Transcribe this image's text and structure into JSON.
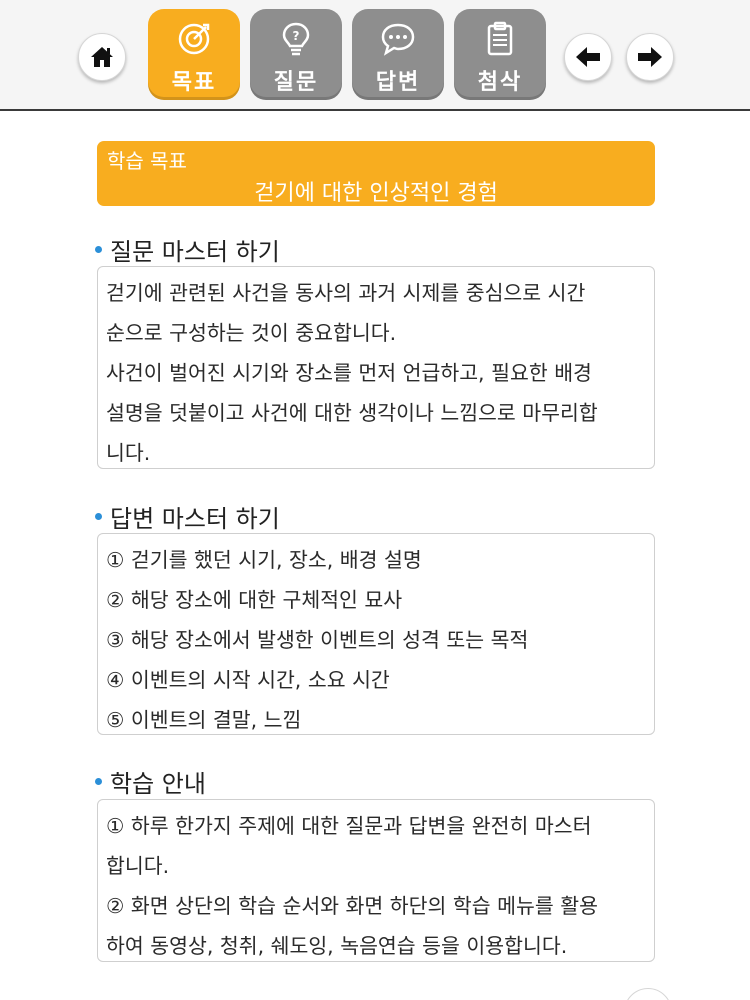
{
  "nav": {
    "tabs": [
      {
        "label": "목표",
        "icon": "target-icon",
        "active": true
      },
      {
        "label": "질문",
        "icon": "lightbulb-icon",
        "active": false
      },
      {
        "label": "답변",
        "icon": "speech-bubble-icon",
        "active": false
      },
      {
        "label": "첨삭",
        "icon": "clipboard-icon",
        "active": false
      }
    ],
    "home_icon": "home-icon",
    "prev_icon": "arrow-left-icon",
    "next_icon": "arrow-right-icon"
  },
  "colors": {
    "accent": "#f8ad1f",
    "tab_inactive": "#8e8e8e",
    "bullet": "#2b8fd8"
  },
  "goal": {
    "label": "학습 목표",
    "topic": "걷기에 대한 인상적인 경험"
  },
  "sections": [
    {
      "title": "질문 마스터 하기",
      "lines": [
        "걷기에 관련된 사건을 동사의 과거 시제를 중심으로 시간",
        "순으로 구성하는 것이 중요합니다.",
        "사건이 벌어진 시기와 장소를 먼저 언급하고, 필요한 배경",
        "설명을 덧붙이고 사건에 대한 생각이나 느낌으로 마무리합",
        "니다."
      ]
    },
    {
      "title": "답변 마스터 하기",
      "lines": [
        "① 걷기를 했던 시기, 장소, 배경 설명",
        "② 해당 장소에 대한 구체적인 묘사",
        "③ 해당 장소에서 발생한 이벤트의 성격 또는 목적",
        "④ 이벤트의 시작 시간, 소요 시간",
        "⑤ 이벤트의 결말, 느낌"
      ]
    },
    {
      "title": "학습 안내",
      "lines": [
        "① 하루 한가지 주제에 대한 질문과 답변을 완전히 마스터",
        "합니다.",
        "② 화면 상단의 학습 순서와 화면 하단의 학습 메뉴를 활용",
        "하여 동영상, 청취, 쉐도잉, 녹음연습 등을 이용합니다."
      ]
    }
  ]
}
